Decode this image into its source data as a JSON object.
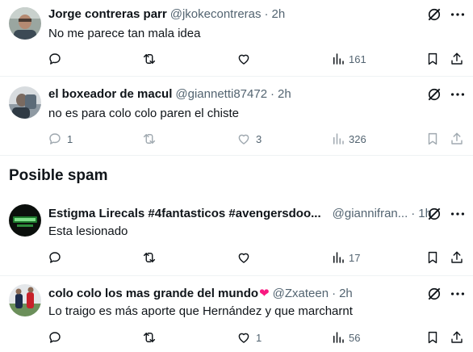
{
  "section": {
    "title": "Posible spam"
  },
  "tweets": [
    {
      "name": "Jorge contreras parr",
      "handle": "@jkokecontreras",
      "time": "2h",
      "text": "No me parece tan mala idea",
      "replies": "",
      "reposts": "",
      "likes": "",
      "views": "161"
    },
    {
      "name": "el boxeador de macul",
      "handle": "@giannetti87472",
      "time": "2h",
      "text": "no es para colo colo paren el chiste",
      "replies": "1",
      "reposts": "",
      "likes": "3",
      "views": "326"
    },
    {
      "name": "Estigma Lirecals #4fantasticos #avengersdoo...",
      "handle": "@giannifran...",
      "time": "1h",
      "text": "Esta lesionado",
      "replies": "",
      "reposts": "",
      "likes": "",
      "views": "17"
    },
    {
      "name": "colo colo los mas grande del mundo",
      "name_emoji": "❤️",
      "handle": "@Zxateen",
      "time": "2h",
      "text": "Lo traigo es más aporte que Hernández y que marcharnt",
      "replies": "",
      "reposts": "",
      "likes": "1",
      "views": "56"
    }
  ],
  "separator": "·",
  "icons": {
    "reply": "reply-icon",
    "repost": "repost-icon",
    "like": "heart-icon",
    "views": "views-icon",
    "bookmark": "bookmark-icon",
    "share": "share-icon",
    "grok": "grok-icon",
    "more": "more-icon"
  },
  "colors": {
    "text": "#0f1419",
    "secondary": "#536471",
    "divider": "#eff3f4",
    "heart_emoji": "#f91880"
  }
}
